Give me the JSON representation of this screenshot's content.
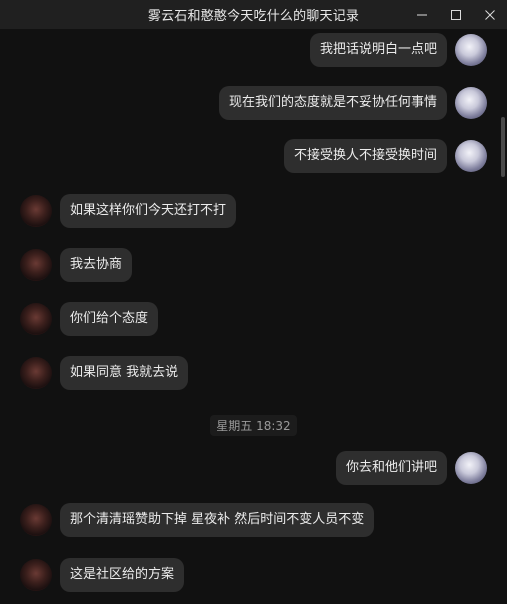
{
  "window": {
    "title": "雾云石和憨憨今天吃什么的聊天记录"
  },
  "messages": [
    {
      "side": "right",
      "text": "我把话说明白一点吧"
    },
    {
      "side": "right",
      "text": "现在我们的态度就是不妥协任何事情"
    },
    {
      "side": "right",
      "text": "不接受换人不接受换时间"
    },
    {
      "side": "left",
      "text": "如果这样你们今天还打不打"
    },
    {
      "side": "left",
      "text": "我去协商"
    },
    {
      "side": "left",
      "text": "你们给个态度"
    },
    {
      "side": "left",
      "text": "如果同意 我就去说"
    },
    {
      "side": "right",
      "text": "你去和他们讲吧"
    },
    {
      "side": "left",
      "text": "那个清清瑶赞助下掉 星夜补 然后时间不变人员不变"
    },
    {
      "side": "left",
      "text": "这是社区给的方案"
    }
  ],
  "timestamp": "星期五 18:32"
}
